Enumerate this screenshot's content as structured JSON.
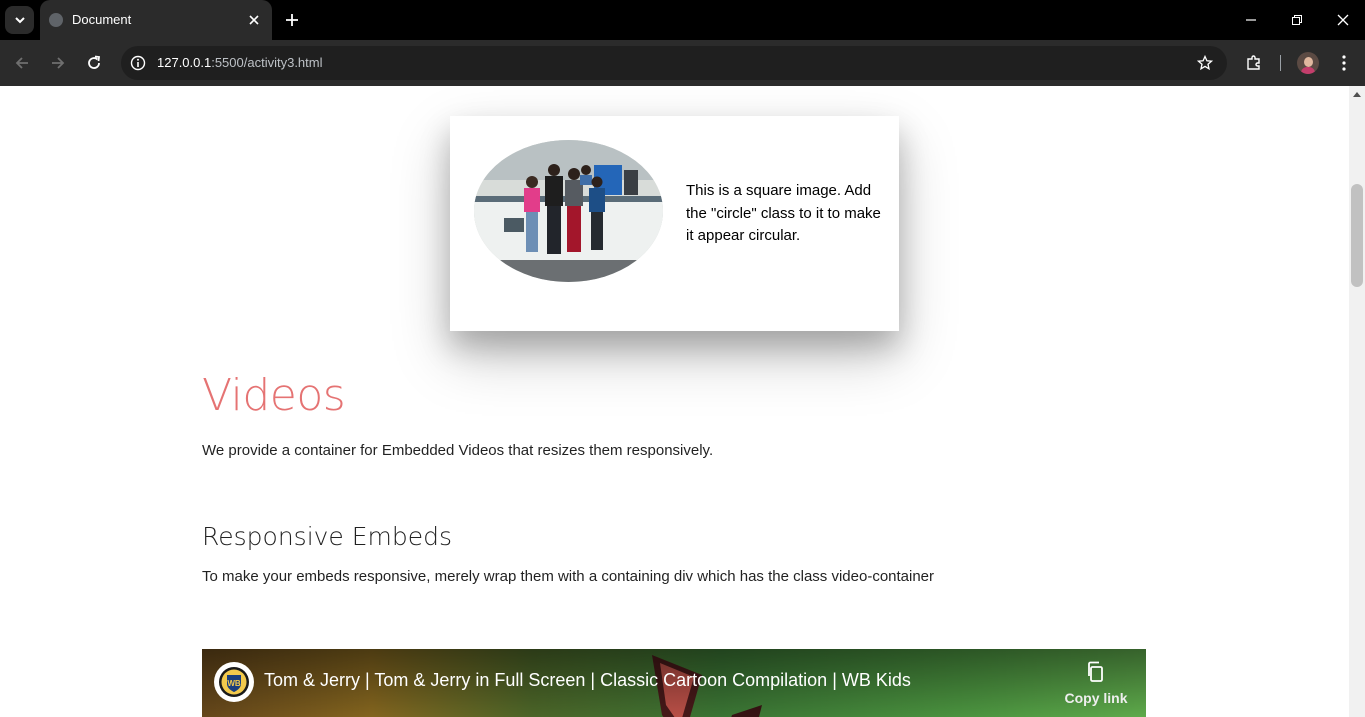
{
  "browser": {
    "tab_title": "Document",
    "url_host": "127.0.0.1",
    "url_rest": ":5500/activity3.html"
  },
  "card": {
    "text": "This is a square image. Add the \"circle\" class to it to make it appear circular."
  },
  "videos_section": {
    "heading": "Videos",
    "description": "We provide a container for Embedded Videos that resizes them responsively."
  },
  "embeds_section": {
    "heading": "Responsive Embeds",
    "description": "To make your embeds responsive, merely wrap them with a containing div which has the class video-container"
  },
  "video": {
    "title": "Tom & Jerry | Tom & Jerry in Full Screen | Classic Cartoon Compilation | WB Kids",
    "copy_label": "Copy link",
    "channel_logo_text": "WB"
  },
  "colors": {
    "heading_accent": "#e57373",
    "chrome_dark": "#2b2b2b"
  }
}
